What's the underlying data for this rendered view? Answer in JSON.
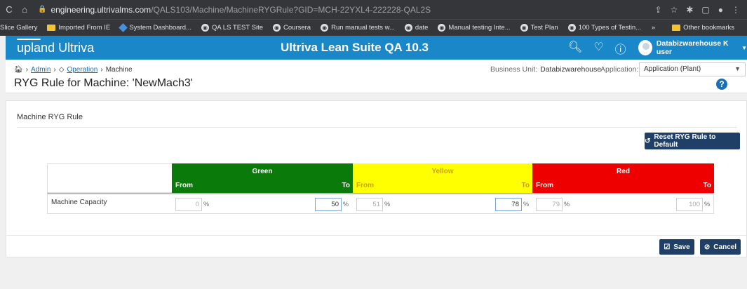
{
  "browser": {
    "url_host": "engineering.ultrivalms.com",
    "url_path": "/QALS103/Machine/MachineRYGRule?GID=MCH-22YXL4-222228-QAL2S",
    "bookmarks": [
      {
        "label": "Slice Gallery",
        "icon": "page-icon"
      },
      {
        "label": "Imported From IE",
        "icon": "folder-icon"
      },
      {
        "label": "System Dashboard...",
        "icon": "jira-icon"
      },
      {
        "label": "QA LS TEST Site",
        "icon": "globe-icon"
      },
      {
        "label": "Coursera",
        "icon": "globe-icon"
      },
      {
        "label": "Run manual tests w...",
        "icon": "globe-icon"
      },
      {
        "label": "date",
        "icon": "globe-icon"
      },
      {
        "label": "Manual testing Inte...",
        "icon": "globe-icon"
      },
      {
        "label": "Test Plan",
        "icon": "globe-icon"
      },
      {
        "label": "100 Types of Testin...",
        "icon": "globe-icon"
      }
    ],
    "more_label": "»",
    "other_bookmarks": "Other bookmarks"
  },
  "header": {
    "logo_a": "upland",
    "logo_b": "Ultriva",
    "title": "Ultriva Lean Suite QA 10.3",
    "user": "Databizwarehouse K user"
  },
  "breadcrumb": {
    "items": [
      "Admin",
      "Operation",
      "Machine"
    ]
  },
  "page": {
    "title": "RYG Rule for Machine: 'NewMach3'",
    "business_unit_label": "Business Unit:",
    "business_unit_value": "Databizwarehouse",
    "application_label": "Application:",
    "application_value": "Application (Plant)"
  },
  "section": {
    "title": "Machine RYG Rule",
    "reset_label": "Reset RYG Rule to Default"
  },
  "ryg": {
    "from_label": "From",
    "to_label": "To",
    "pct": "%",
    "groups": [
      {
        "name": "Green",
        "color": "#0a7a0a"
      },
      {
        "name": "Yellow",
        "color": "#ffff00"
      },
      {
        "name": "Red",
        "color": "#ee0000"
      }
    ],
    "rows": [
      {
        "label": "Machine Capacity",
        "values": [
          "0",
          "50",
          "51",
          "78",
          "79",
          "100"
        ]
      }
    ]
  },
  "actions": {
    "save": "Save",
    "cancel": "Cancel"
  }
}
